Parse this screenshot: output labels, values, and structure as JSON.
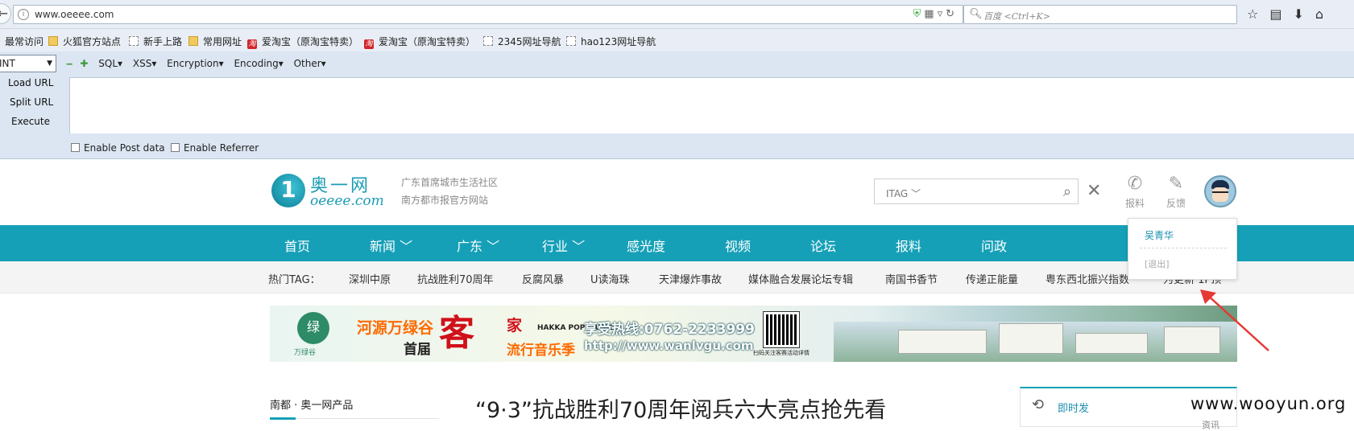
{
  "browser": {
    "url": "www.oeeee.com",
    "search_placeholder": "百度 <Ctrl+K>",
    "bookmarks": [
      "最常访问",
      "火狐官方站点",
      "新手上路",
      "常用网址",
      "爱淘宝（原淘宝特卖）",
      "爱淘宝（原淘宝特卖）",
      "2345网址导航",
      "hao123网址导航"
    ]
  },
  "hackbar": {
    "select_value": "INT",
    "menu": [
      "SQL▾",
      "XSS▾",
      "Encryption▾",
      "Encoding▾",
      "Other▾"
    ],
    "load_url": "Load URL",
    "split_url": "Split URL",
    "execute": "Execute",
    "enable_post": "Enable Post data",
    "enable_referrer": "Enable Referrer"
  },
  "site": {
    "logo_name": "奥一网",
    "logo_domain": "oeeee.com",
    "slogan1": "广东首席城市生活社区",
    "slogan2": "南方都市报官方网站",
    "search_scope": "ITAG ﹀",
    "report_label": "报料",
    "feedback_label": "反馈",
    "nav": [
      "首页",
      "新闻 ﹀",
      "广东 ﹀",
      "行业 ﹀",
      "感光度",
      "视频",
      "论坛",
      "报料",
      "问政"
    ],
    "tag_prefix": "热门TAG：",
    "tags": [
      "深圳中原",
      "抗战胜利70周年",
      "反腐风暴",
      "U读海珠",
      "天津爆炸事故",
      "媒体融合发展论坛专辑",
      "南国书香节",
      "传递正能量",
      "粤东西北振兴指数",
      "为更新 1P顶"
    ],
    "user": {
      "name": "吴青华",
      "logout": "[退出]"
    },
    "banner": {
      "logo_char": "绿",
      "brand": "万绿谷",
      "line1": "河源万绿谷",
      "line2": "首届",
      "big": "客",
      "line3": "家",
      "line4": "流行音乐季",
      "hakka": "HAKKA POP MUSIC",
      "phone": "享受热线:0762-2233999",
      "url": "http://www.wanlvgu.com",
      "qr_caption": "扫码关注客赛活动详情"
    },
    "products_title": "南都 · 奥一网产品",
    "headline": "“9·3”抗战胜利70周年阅兵六大亮点抢先看",
    "live_title": "即时发",
    "live_sub": "资讯"
  },
  "watermark": "www.wooyun.org",
  "colors": {
    "brand": "#16a0b8",
    "annotation_arrow": "#e53935"
  }
}
